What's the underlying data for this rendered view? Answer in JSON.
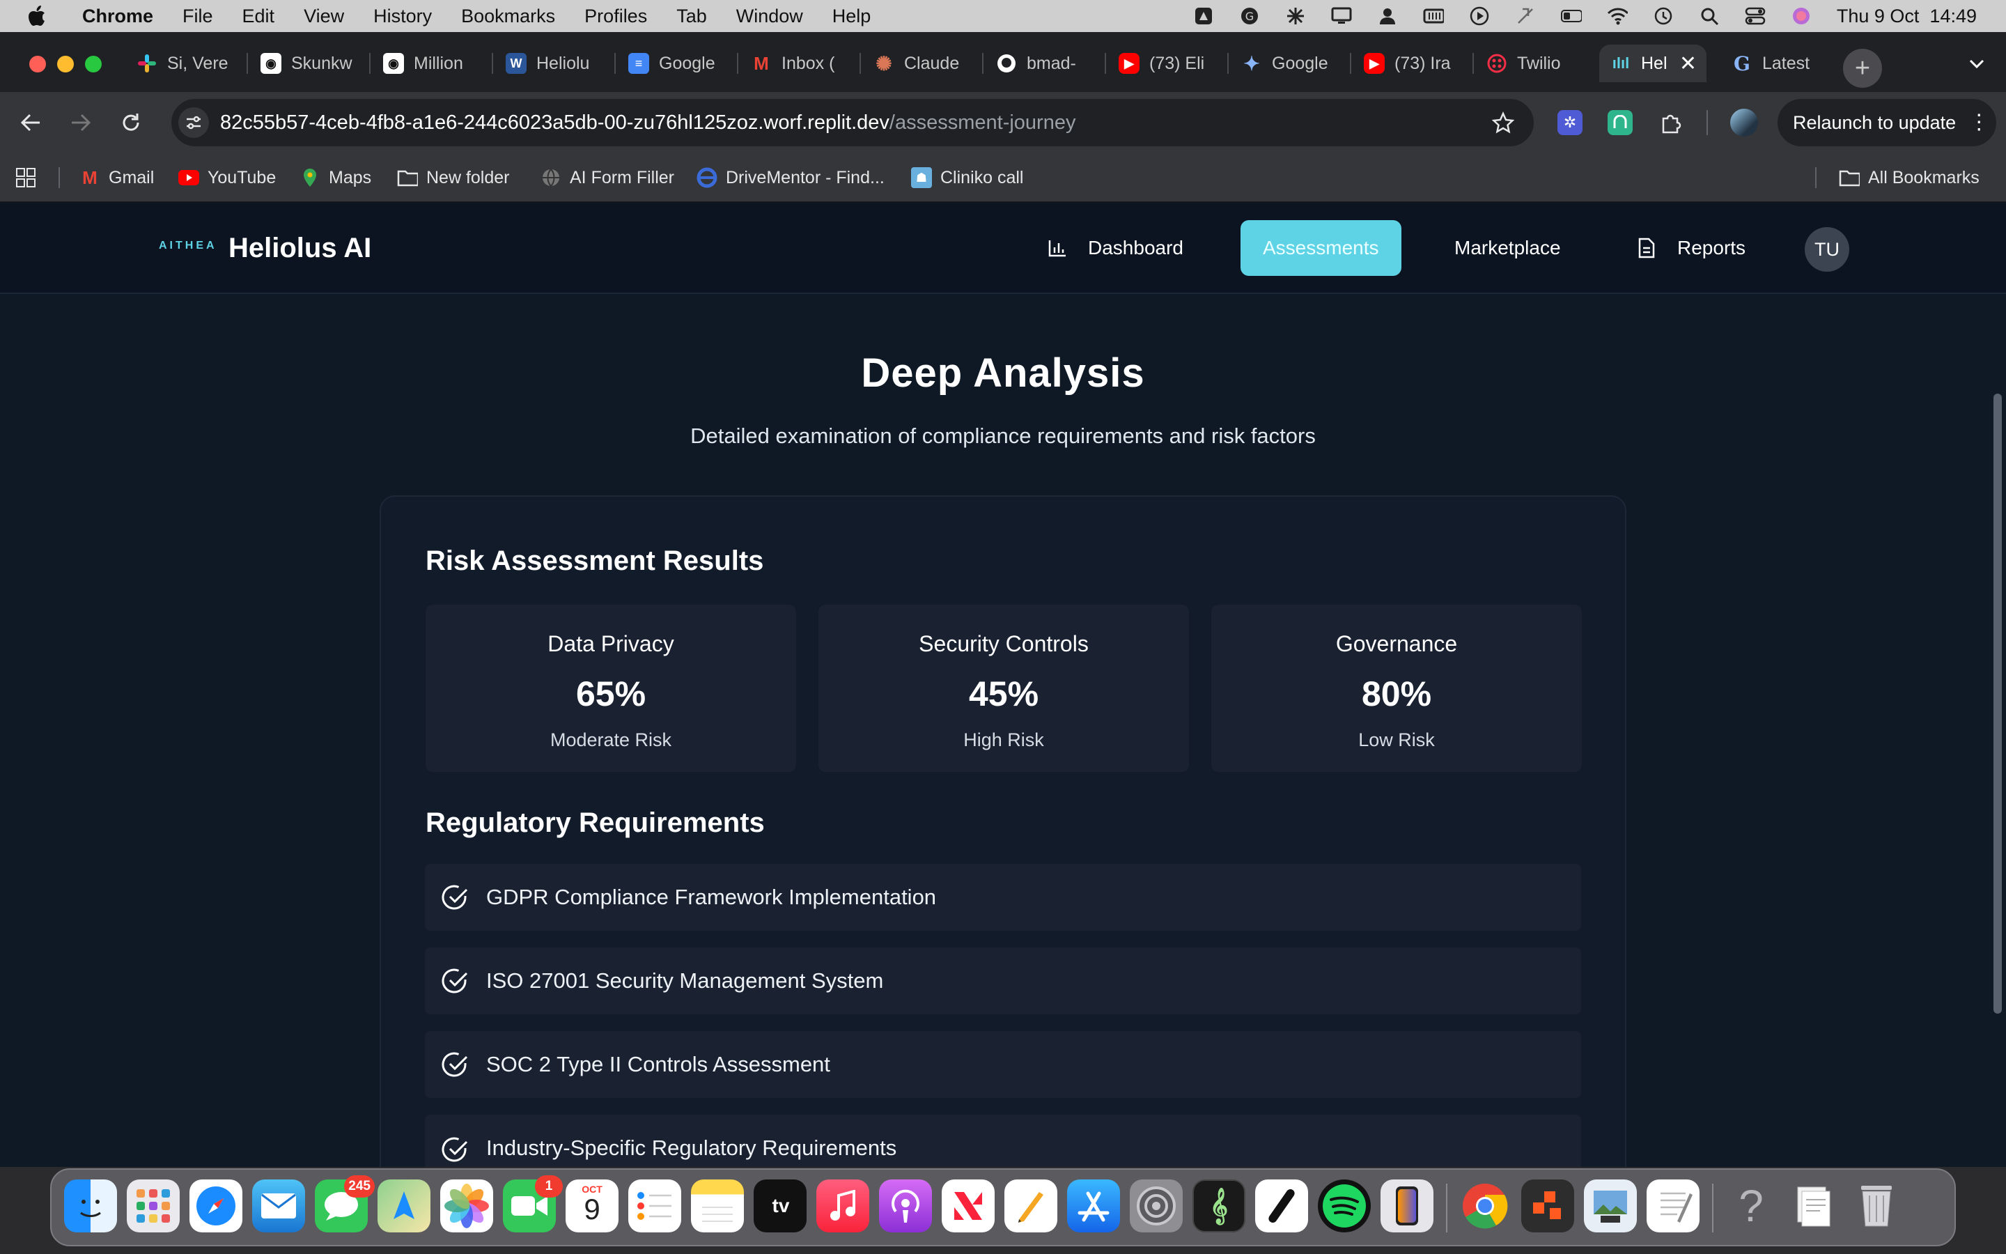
{
  "menubar": {
    "app": "Chrome",
    "items": [
      "File",
      "Edit",
      "View",
      "History",
      "Bookmarks",
      "Profiles",
      "Tab",
      "Window",
      "Help"
    ],
    "clock": "Thu 9 Oct  14:49"
  },
  "tabs": [
    {
      "label": "Si, Vere",
      "icon": "slack-icon",
      "color": "#e01e5a"
    },
    {
      "label": "Skunkw",
      "icon": "app-icon",
      "color": "#ffffff"
    },
    {
      "label": "Million",
      "icon": "app-icon",
      "color": "#ffffff"
    },
    {
      "label": "Heliolu",
      "icon": "word-icon",
      "color": "#2b579a"
    },
    {
      "label": "Google",
      "icon": "docs-icon",
      "color": "#4285f4"
    },
    {
      "label": "Inbox (",
      "icon": "gmail-icon",
      "color": "#ea4335"
    },
    {
      "label": "Claude",
      "icon": "claude-icon",
      "color": "#d97757"
    },
    {
      "label": "bmad-",
      "icon": "github-icon",
      "color": "#ffffff"
    },
    {
      "label": "(73) Eli",
      "icon": "youtube-icon",
      "color": "#ff0000"
    },
    {
      "label": "Google",
      "icon": "gemini-icon",
      "color": "#4285f4"
    },
    {
      "label": "(73) Ira",
      "icon": "youtube-icon",
      "color": "#ff0000"
    },
    {
      "label": "Twilio",
      "icon": "twilio-icon",
      "color": "#f22f46"
    },
    {
      "label": "Hel",
      "icon": "heliolus-icon",
      "color": "#5fd3e6",
      "active": true
    },
    {
      "label": "Latest",
      "icon": "google-icon",
      "color": "#4285f4"
    }
  ],
  "address_bar": {
    "host": "82c55b57-4ceb-4fb8-a1e6-244c6023a5db-00-zu76hl125zoz.worf.replit.dev",
    "path": "/assessment-journey"
  },
  "relaunch_label": "Relaunch to update",
  "bookmarks": [
    {
      "label": "Gmail",
      "icon": "gmail-icon"
    },
    {
      "label": "YouTube",
      "icon": "youtube-icon"
    },
    {
      "label": "Maps",
      "icon": "maps-icon"
    },
    {
      "label": "New folder",
      "icon": "folder-icon"
    },
    {
      "label": "AI Form Filler",
      "icon": "globe-icon"
    },
    {
      "label": "DriveMentor - Find...",
      "icon": "drivementor-icon"
    },
    {
      "label": "Cliniko call",
      "icon": "cliniko-icon"
    }
  ],
  "all_bookmarks_label": "All Bookmarks",
  "nav": {
    "logo_text": "AITHEA",
    "brand": "Heliolus AI",
    "dashboard": "Dashboard",
    "assessments": "Assessments",
    "marketplace": "Marketplace",
    "reports": "Reports",
    "avatar": "TU"
  },
  "page": {
    "title": "Deep Analysis",
    "subtitle": "Detailed examination of compliance requirements and risk factors"
  },
  "risk": {
    "title": "Risk Assessment Results",
    "metrics": [
      {
        "label": "Data Privacy",
        "value": "65%",
        "risk": "Moderate Risk"
      },
      {
        "label": "Security Controls",
        "value": "45%",
        "risk": "High Risk"
      },
      {
        "label": "Governance",
        "value": "80%",
        "risk": "Low Risk"
      }
    ]
  },
  "regulatory": {
    "title": "Regulatory Requirements",
    "items": [
      "GDPR Compliance Framework Implementation",
      "ISO 27001 Security Management System",
      "SOC 2 Type II Controls Assessment",
      "Industry-Specific Regulatory Requirements"
    ]
  },
  "dock": {
    "messages_badge": "245",
    "facetime_badge": "1",
    "calendar_month": "OCT",
    "calendar_day": "9",
    "tv_label": "tv"
  }
}
